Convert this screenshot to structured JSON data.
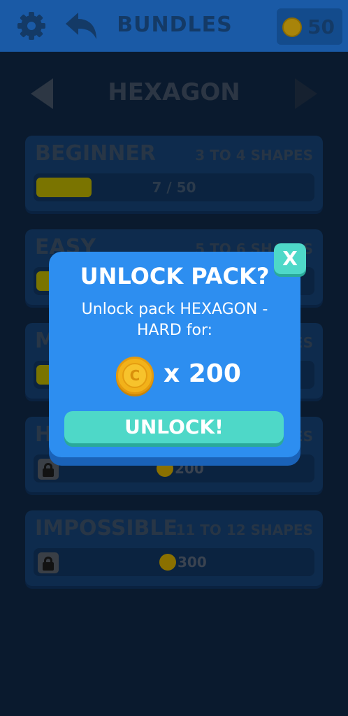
{
  "header": {
    "title": "BUNDLES",
    "coins": "50"
  },
  "pack": {
    "title": "HEXAGON"
  },
  "levels": [
    {
      "name": "BEGINNER",
      "subtitle": "3 TO 4 SHAPES",
      "progress_text": "7 / 50",
      "progress_fraction": 0.2
    },
    {
      "name": "EASY",
      "subtitle": "5 TO 6 SHAPES"
    },
    {
      "name": "M",
      "subtitle": "ES"
    },
    {
      "name": "H",
      "subtitle": "ES",
      "price": "200"
    },
    {
      "name": "IMPOSSIBLE",
      "subtitle": "11 TO 12 SHAPES",
      "price": "300"
    }
  ],
  "dialog": {
    "title": "UNLOCK PACK?",
    "message": "Unlock pack HEXAGON - HARD for:",
    "cost": "x 200",
    "coin_letter": "C",
    "unlock_label": "UNLOCK!",
    "close_label": "X"
  },
  "colors": {
    "dialog": "#2d8ef0",
    "button": "#4ed8c8",
    "coin": "#f2b21a"
  },
  "icons": [
    "gear-icon",
    "back-arrow-icon",
    "coin-icon",
    "arrow-left-icon",
    "arrow-right-icon",
    "lock-icon"
  ]
}
